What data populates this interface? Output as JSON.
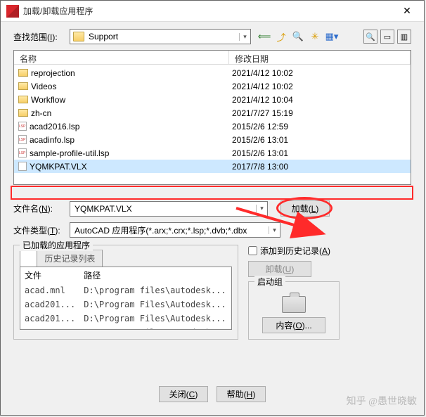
{
  "title": "加载/卸载应用程序",
  "lookin": {
    "label": "查找范围",
    "key": "I",
    "value": "Support"
  },
  "toolbar_icons": [
    "back-icon",
    "up-icon",
    "search-icon",
    "new-folder-icon",
    "views-icon"
  ],
  "right_icons": [
    "preview-icon",
    "tools-icon",
    "menu-icon"
  ],
  "columns": {
    "name": "名称",
    "date": "修改日期"
  },
  "files": [
    {
      "icon": "folder",
      "name": "reprojection",
      "date": "2021/4/12 10:02"
    },
    {
      "icon": "folder",
      "name": "Videos",
      "date": "2021/4/12 10:02"
    },
    {
      "icon": "folder",
      "name": "Workflow",
      "date": "2021/4/12 10:04"
    },
    {
      "icon": "folder",
      "name": "zh-cn",
      "date": "2021/7/27 15:19"
    },
    {
      "icon": "lsp",
      "name": "acad2016.lsp",
      "date": "2015/2/6 12:59"
    },
    {
      "icon": "lsp",
      "name": "acadinfo.lsp",
      "date": "2015/2/6 13:01"
    },
    {
      "icon": "lsp",
      "name": "sample-profile-util.lsp",
      "date": "2015/2/6 13:01"
    },
    {
      "icon": "file",
      "name": "YQMKPAT.VLX",
      "date": "2017/7/8 13:00",
      "selected": true
    }
  ],
  "filename": {
    "label": "文件名",
    "key": "N",
    "value": "YQMKPAT.VLX"
  },
  "filetype": {
    "label": "文件类型",
    "key": "T",
    "value": "AutoCAD 应用程序(*.arx;*.crx;*.lsp;*.dvb;*.dbx"
  },
  "load_btn": {
    "label": "加载",
    "key": "L"
  },
  "loaded": {
    "group_label": "已加载的应用程序",
    "tab_history": "历史记录列表",
    "col_file": "文件",
    "col_path": "路径",
    "rows": [
      {
        "file": "acad.mnl",
        "path": "D:\\program files\\autodesk..."
      },
      {
        "file": "acad201...",
        "path": "D:\\Program Files\\Autodesk..."
      },
      {
        "file": "acad201...",
        "path": "D:\\Program Files\\Autodesk..."
      },
      {
        "file": "acapp.arx",
        "path": "D:\\Program Files\\Autodesk..."
      }
    ]
  },
  "add_history": {
    "label": "添加到历史记录",
    "key": "A"
  },
  "unload_btn": {
    "label": "卸载",
    "key": "U"
  },
  "startup": {
    "label": "启动组",
    "contents_label": "内容",
    "key": "O"
  },
  "close_btn": {
    "label": "关闭",
    "key": "C"
  },
  "help_btn": {
    "label": "帮助",
    "key": "H"
  },
  "watermark": "知乎 @愚世晓敏"
}
